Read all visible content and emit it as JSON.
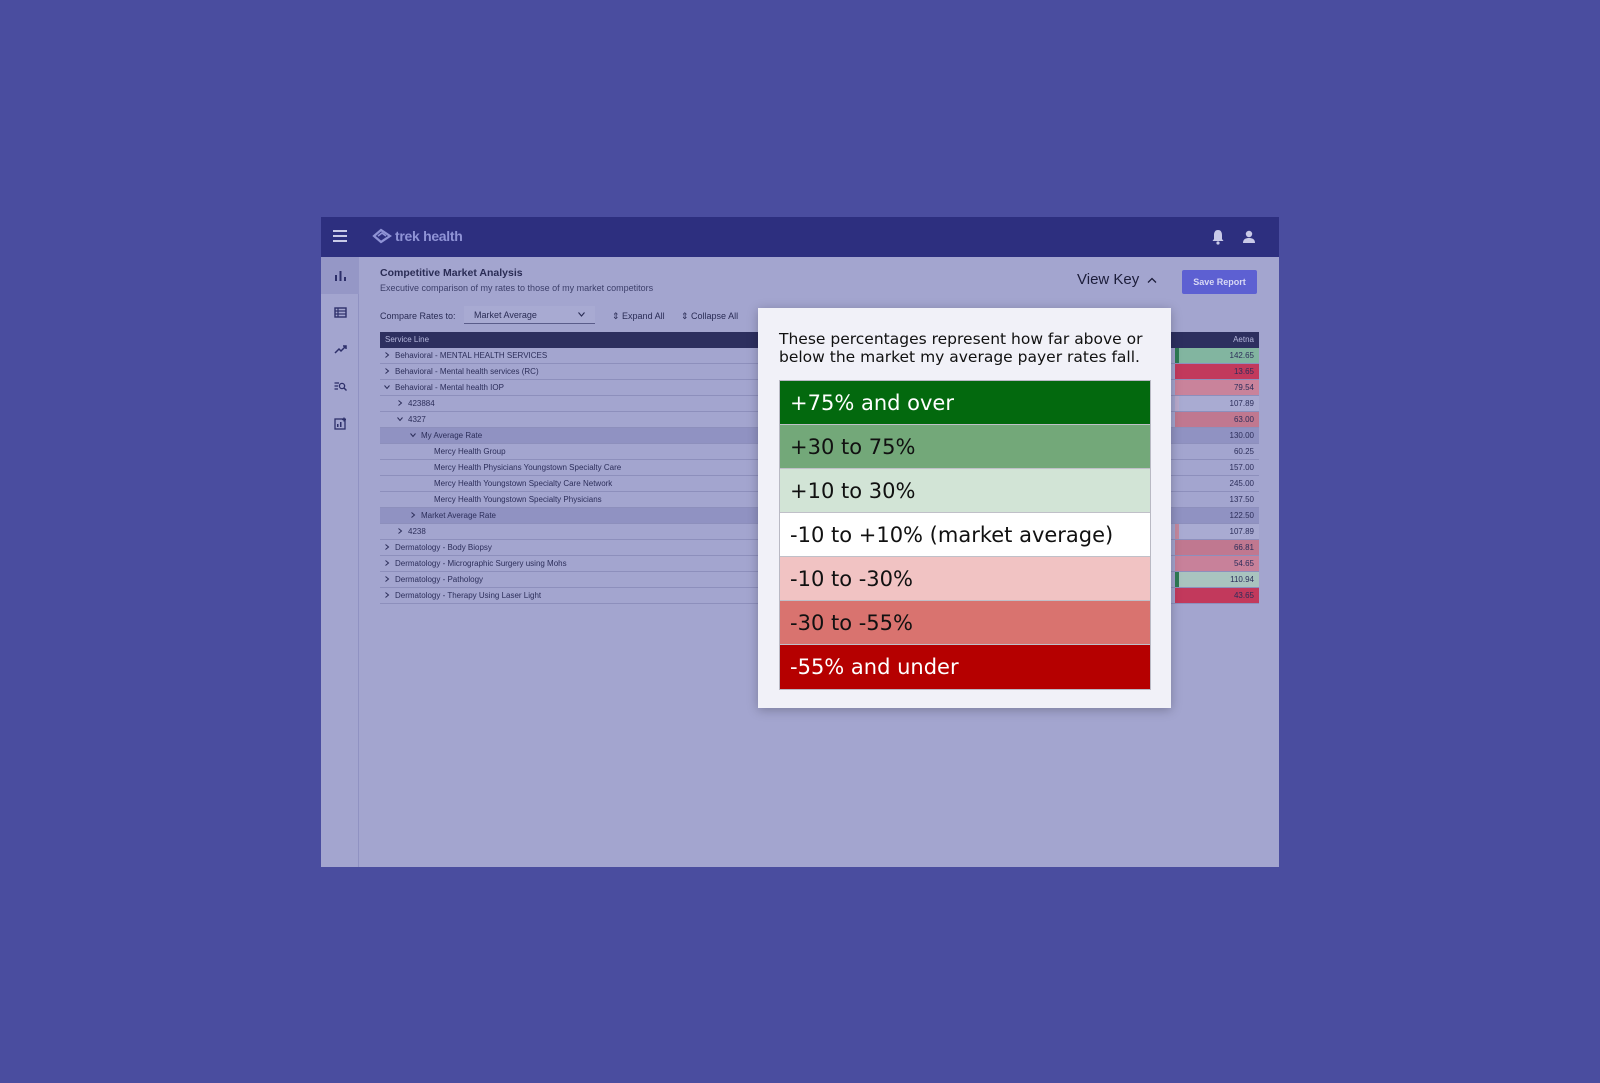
{
  "app": {
    "logo_text": "trek health",
    "icons": {
      "menu": "menu-icon",
      "bell": "bell-icon",
      "user": "user-icon"
    }
  },
  "sidebar": {
    "items": [
      {
        "name": "sidebar-item-dashboard",
        "icon": "bar-chart-icon"
      },
      {
        "name": "sidebar-item-table",
        "icon": "table-icon"
      },
      {
        "name": "sidebar-item-trends",
        "icon": "trend-icon"
      },
      {
        "name": "sidebar-item-search",
        "icon": "search-list-icon"
      },
      {
        "name": "sidebar-item-report",
        "icon": "report-add-icon"
      }
    ]
  },
  "header": {
    "title": "Competitive Market Analysis",
    "subtitle": "Executive comparison of my rates to those of my market competitors",
    "view_key_label": "View Key",
    "save_label": "Save Report"
  },
  "controls": {
    "compare_label": "Compare Rates to:",
    "compare_value": "Market Average",
    "expand_all": "Expand All",
    "collapse_all": "Collapse All"
  },
  "table": {
    "columns": [
      "Service Line",
      "Aetna"
    ],
    "rows": [
      {
        "label": "Behavioral - MENTAL HEALTH SERVICES",
        "value": "142.65",
        "indent": 0,
        "caret": "right",
        "color": "#82b5a0",
        "stripe": "#2f7a55"
      },
      {
        "label": "Behavioral - Mental health services (RC)",
        "value": "13.65",
        "indent": 0,
        "caret": "right",
        "color": "#c2395c",
        "stripe": "#c2395c"
      },
      {
        "label": "Behavioral - Mental health IOP",
        "value": "79.54",
        "indent": 0,
        "caret": "down",
        "color": "#c9839b",
        "stripe": "#c9839b"
      },
      {
        "label": "423884",
        "value": "107.89",
        "indent": 1,
        "caret": "right",
        "color": "#a9abd2",
        "stripe": "#b8a9cb"
      },
      {
        "label": "4327",
        "value": "63.00",
        "indent": 1,
        "caret": "down",
        "color": "#c07890",
        "stripe": "#c07890"
      },
      {
        "label": "My Average Rate",
        "value": "130.00",
        "indent": 2,
        "caret": "down",
        "color": "#9092c2",
        "stripe": "#9092c2",
        "selected": true
      },
      {
        "label": "Mercy Health Group",
        "value": "60.25",
        "indent": 3,
        "caret": "",
        "color": "#a3a5cf",
        "stripe": "#a3a5cf"
      },
      {
        "label": "Mercy Health Physicians Youngstown Specialty Care",
        "value": "157.00",
        "indent": 3,
        "caret": "",
        "color": "#a3a5cf",
        "stripe": "#a3a5cf"
      },
      {
        "label": "Mercy Health Youngstown Specialty Care Network",
        "value": "245.00",
        "indent": 3,
        "caret": "",
        "color": "#a3a5cf",
        "stripe": "#a3a5cf"
      },
      {
        "label": "Mercy Health Youngstown Specialty Physicians",
        "value": "137.50",
        "indent": 3,
        "caret": "",
        "color": "#a3a5cf",
        "stripe": "#a3a5cf"
      },
      {
        "label": "Market Average Rate",
        "value": "122.50",
        "indent": 2,
        "caret": "right",
        "color": "#9092c2",
        "stripe": "#9092c2",
        "selected": true
      },
      {
        "label": "4238",
        "value": "107.89",
        "indent": 1,
        "caret": "right",
        "color": "#a9abd2",
        "stripe": "#c4889e"
      },
      {
        "label": "Dermatology - Body Biopsy",
        "value": "66.81",
        "indent": 0,
        "caret": "right",
        "color": "#c07890",
        "stripe": "#c07890"
      },
      {
        "label": "Dermatology - Micrographic Surgery using Mohs",
        "value": "54.65",
        "indent": 0,
        "caret": "right",
        "color": "#c8819a",
        "stripe": "#c8819a"
      },
      {
        "label": "Dermatology - Pathology",
        "value": "110.94",
        "indent": 0,
        "caret": "right",
        "color": "#a9c4bf",
        "stripe": "#2f7a55"
      },
      {
        "label": "Dermatology - Therapy Using Laser Light",
        "value": "43.65",
        "indent": 0,
        "caret": "right",
        "color": "#c2395c",
        "stripe": "#c2395c"
      }
    ]
  },
  "key": {
    "description": "These percentages represent how far above or below the market my average payer rates fall.",
    "items": [
      {
        "label": "+75% and over",
        "bg": "#03690e",
        "fg": "#ffffff"
      },
      {
        "label": "+30 to 75%",
        "bg": "#73a879",
        "fg": "#111111"
      },
      {
        "label": "+10 to 30%",
        "bg": "#d2e4d6",
        "fg": "#111111"
      },
      {
        "label": "-10 to +10% (market average)",
        "bg": "#ffffff",
        "fg": "#111111"
      },
      {
        "label": "-10 to -30%",
        "bg": "#f1c3c3",
        "fg": "#111111"
      },
      {
        "label": "-30 to -55%",
        "bg": "#d9736f",
        "fg": "#111111"
      },
      {
        "label": "-55% and under",
        "bg": "#b50000",
        "fg": "#ffffff"
      }
    ]
  }
}
